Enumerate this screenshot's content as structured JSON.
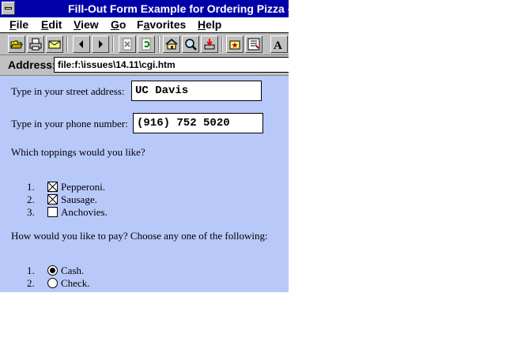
{
  "window": {
    "title": "Fill-Out Form Example for Ordering Pizza  -"
  },
  "menubar": {
    "items": [
      {
        "label": "File",
        "accel": "F"
      },
      {
        "label": "Edit",
        "accel": "E"
      },
      {
        "label": "View",
        "accel": "V"
      },
      {
        "label": "Go",
        "accel": "G"
      },
      {
        "label": "Favorites",
        "accel": "a"
      },
      {
        "label": "Help",
        "accel": "H"
      }
    ]
  },
  "toolbar": {
    "buttons": [
      "open-icon",
      "print-icon",
      "mail-icon",
      "back-icon",
      "forward-icon",
      "stop-icon",
      "refresh-icon",
      "home-icon",
      "search-icon",
      "download-icon",
      "favorites-icon",
      "add-favorite-icon",
      "font-size-icon"
    ]
  },
  "address": {
    "label": "Address:",
    "value": "file:f:\\issues\\14.11\\cgi.htm"
  },
  "form": {
    "street_label": "Type in your street address:",
    "street_value": "UC Davis",
    "phone_label": "Type in your phone number:",
    "phone_value": "(916) 752 5020",
    "toppings_question": "Which toppings would you like?",
    "toppings": [
      {
        "num": "1.",
        "label": "Pepperoni.",
        "checked": true
      },
      {
        "num": "2.",
        "label": "Sausage.",
        "checked": true
      },
      {
        "num": "3.",
        "label": "Anchovies.",
        "checked": false
      }
    ],
    "payment_question": "How would you like to pay? Choose any one of the following:",
    "payment": [
      {
        "num": "1.",
        "label": "Cash.",
        "selected": true
      },
      {
        "num": "2.",
        "label": "Check.",
        "selected": false
      }
    ]
  },
  "colors": {
    "title_bar": "#0000a8",
    "content_bg": "#b8c8f8",
    "chrome": "#c0c0c0"
  }
}
